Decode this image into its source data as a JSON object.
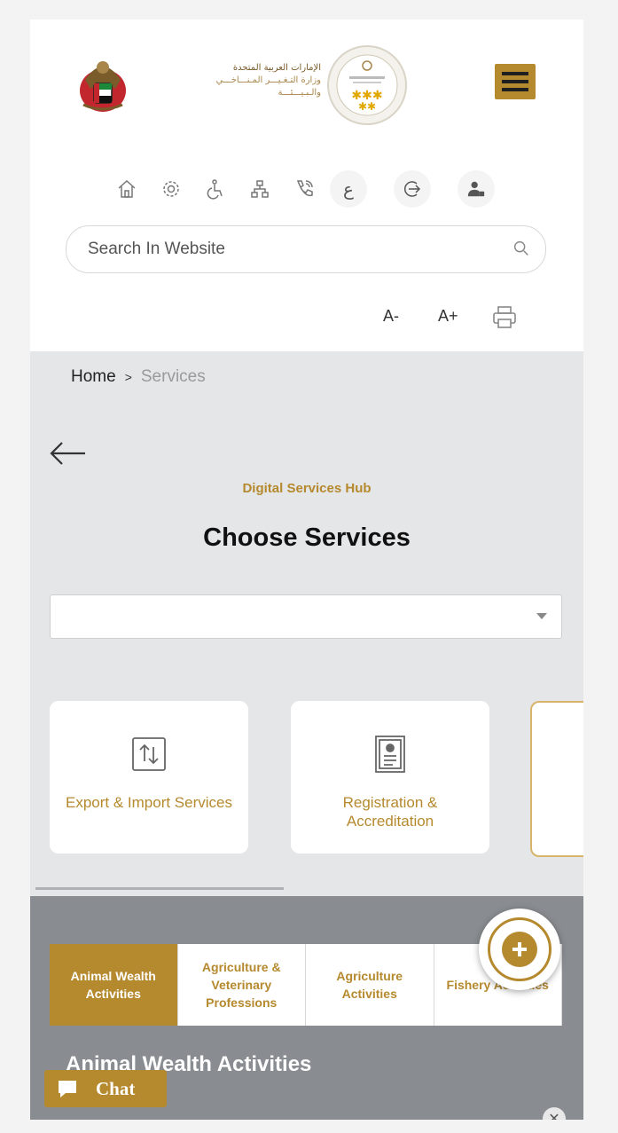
{
  "header": {
    "logo_text_line1": "الإمارات العربية المتحدة",
    "logo_text_line2": "وزارة التـغـيـــر المـنـــاخـــي",
    "logo_text_line3": "والـبـيـــئـــة",
    "menu_icon": "hamburger-icon",
    "top_icons": [
      "home-icon",
      "gear-icon",
      "accessibility-icon",
      "sitemap-icon",
      "phone-icon",
      "arabic-language-icon",
      "login-icon",
      "user-icon"
    ],
    "arabic_glyph": "ع"
  },
  "search": {
    "placeholder": "Search In Website",
    "value": ""
  },
  "font_tools": {
    "decrease": "A-",
    "increase": "A+",
    "print_icon": "printer-icon"
  },
  "breadcrumb": {
    "home": "Home",
    "separator": ">",
    "current": "Services"
  },
  "main": {
    "hub_label": "Digital Services Hub",
    "title": "Choose Services",
    "select_value": ""
  },
  "cards": [
    {
      "label": "Export & Import Services",
      "icon": "export-import-icon"
    },
    {
      "label": "Registration & Accreditation",
      "icon": "certificate-icon"
    }
  ],
  "activities": {
    "tabs": [
      {
        "label": "Animal Wealth Activities",
        "active": true
      },
      {
        "label": "Agriculture & Veterinary Professions",
        "active": false
      },
      {
        "label": "Agriculture Activities",
        "active": false
      },
      {
        "label": "Fishery Activities",
        "active": false
      }
    ],
    "section_title": "Animal Wealth Activities"
  },
  "chat": {
    "label": "Chat"
  },
  "colors": {
    "accent": "#b5892e",
    "panel_gray": "#898d91",
    "background": "#e5e6e8"
  }
}
